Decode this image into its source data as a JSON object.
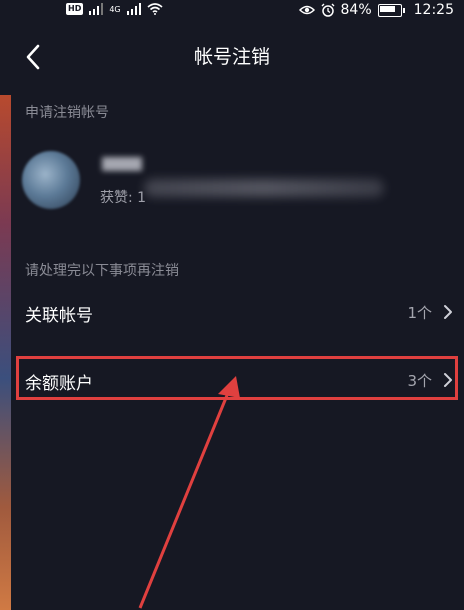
{
  "statusbar": {
    "hd": "HD",
    "network": "4G",
    "battery": "84%",
    "time": "12:25"
  },
  "nav": {
    "title": "帐号注销"
  },
  "apply_section": {
    "label": "申请注销帐号"
  },
  "user": {
    "likes_label": "获赞: 1"
  },
  "todo_section": {
    "label": "请处理完以下事项再注销"
  },
  "rows": [
    {
      "label": "关联帐号",
      "count": "1个"
    },
    {
      "label": "余额账户",
      "count": "3个"
    }
  ],
  "colors": {
    "background": "#161823",
    "highlight": "#e0403f",
    "muted_text": "#8a8b95"
  },
  "icons": [
    "back-icon",
    "chevron-right-icon",
    "eye-icon",
    "alarm-icon",
    "wifi-icon",
    "battery-icon",
    "signal-icon"
  ]
}
